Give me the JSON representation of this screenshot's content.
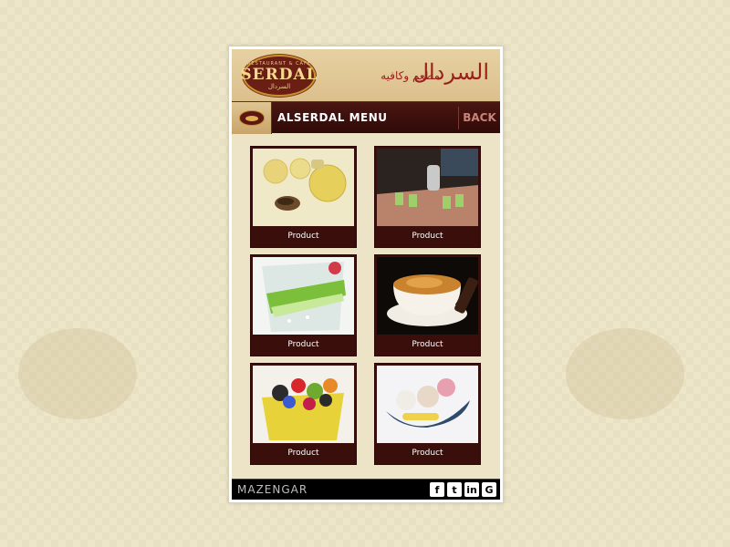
{
  "header": {
    "logo": {
      "text_top": "RESTAURANT & CAFE",
      "text_main": "SERDAL",
      "text_bottom": "السردال"
    },
    "arabic_title": "السردال",
    "arabic_subtitle": "مطعم وكافيه"
  },
  "navbar": {
    "title": "ALSERDAL MENU",
    "back_label": "BACK"
  },
  "products": [
    {
      "label": "Product",
      "image": "tea-pot-and-cups"
    },
    {
      "label": "Product",
      "image": "mint-tea-tray"
    },
    {
      "label": "Product",
      "image": "lime-drink"
    },
    {
      "label": "Product",
      "image": "cappuccino"
    },
    {
      "label": "Product",
      "image": "fruit-salad"
    },
    {
      "label": "Product",
      "image": "ice-cream-boat"
    }
  ],
  "footer": {
    "brand": "MAZENGAR",
    "social": [
      {
        "name": "facebook-icon",
        "glyph": "f"
      },
      {
        "name": "twitter-icon",
        "glyph": "t"
      },
      {
        "name": "linkedin-icon",
        "glyph": "in"
      },
      {
        "name": "google-icon",
        "glyph": "G"
      }
    ]
  },
  "colors": {
    "accent": "#3a0f0b",
    "back": "#c98378",
    "banner": "#dcc08c"
  }
}
